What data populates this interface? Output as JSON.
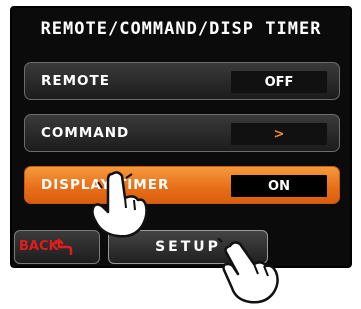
{
  "screen": {
    "title": "REMOTE/COMMAND/DISP TIMER"
  },
  "rows": [
    {
      "label": "REMOTE",
      "value": "OFF",
      "active": false
    },
    {
      "label": "COMMAND",
      "value": ">",
      "active": false
    },
    {
      "label": "DISPLAY TIMER",
      "value": "ON",
      "active": true
    }
  ],
  "bottom": {
    "back_label": "BACK",
    "setup_label": "SETUP"
  },
  "colors": {
    "active_row": "#e9701a",
    "back_text": "#e21c1c",
    "arrow": "#f08a2a"
  },
  "icons": [
    "back-arrow-icon",
    "pointing-hand-icon"
  ]
}
